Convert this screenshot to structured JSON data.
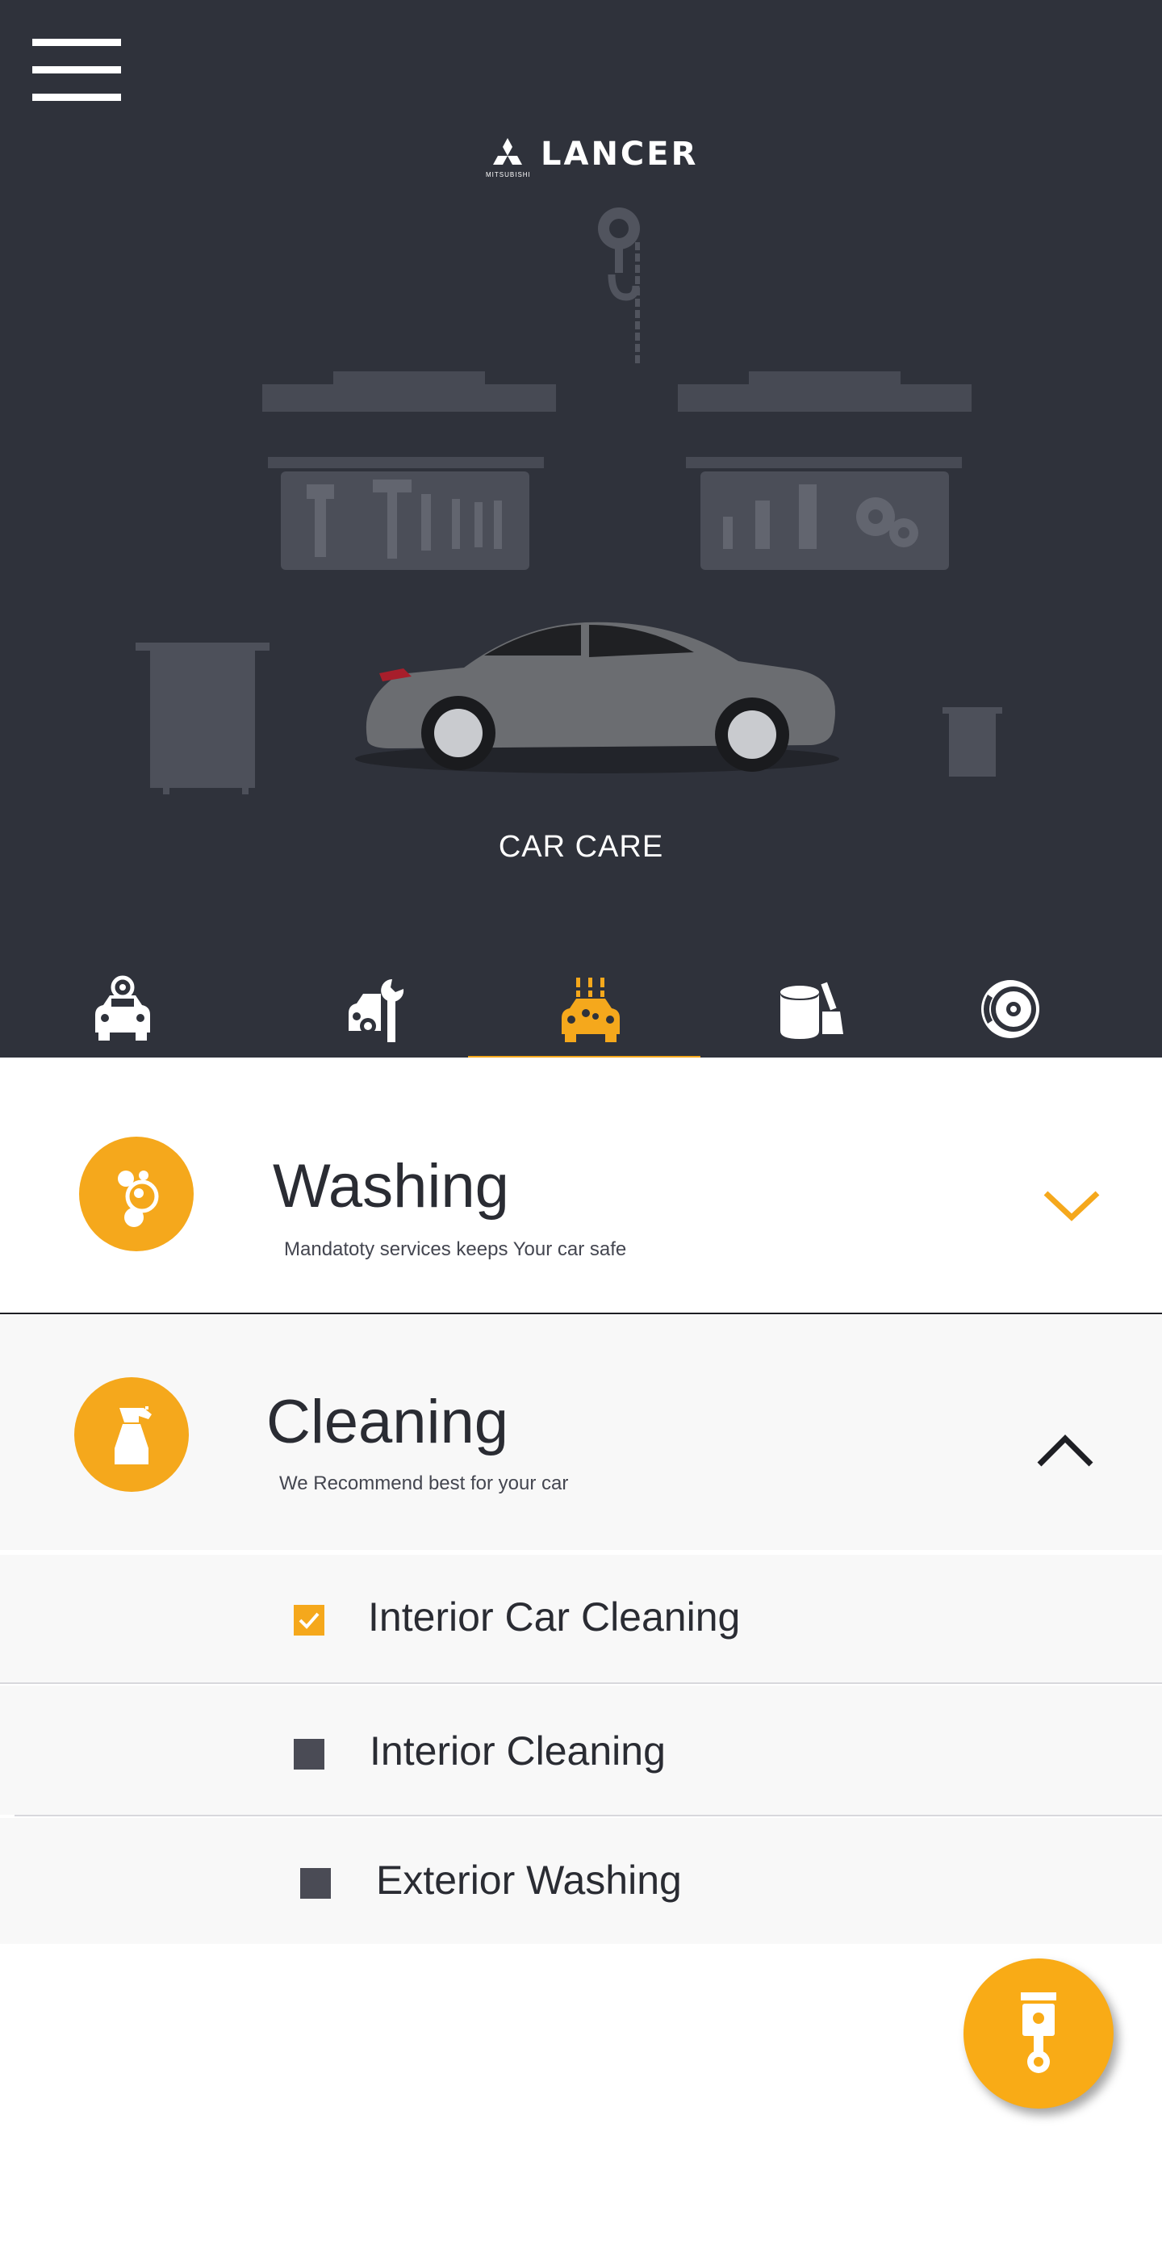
{
  "header": {
    "brand_name": "LANCER",
    "brand_sub": "MITSUBISHI",
    "page_title": "CAR CARE"
  },
  "tabs": [
    {
      "name": "car-service",
      "icon": "car-gear-icon",
      "active": false
    },
    {
      "name": "repair",
      "icon": "car-wrench-icon",
      "active": false
    },
    {
      "name": "car-care",
      "icon": "car-wash-icon",
      "active": true
    },
    {
      "name": "paint",
      "icon": "paint-bucket-icon",
      "active": false
    },
    {
      "name": "brakes",
      "icon": "brake-disc-icon",
      "active": false
    }
  ],
  "sections": {
    "washing": {
      "title": "Washing",
      "subtitle": "Mandatoty services keeps Your car safe",
      "icon": "bubbles-icon",
      "expanded": false
    },
    "cleaning": {
      "title": "Cleaning",
      "subtitle": "We Recommend best for your car",
      "icon": "spray-bottle-icon",
      "expanded": true,
      "items": [
        {
          "label": "Interior Car Cleaning",
          "checked": true
        },
        {
          "label": "Interior Cleaning",
          "checked": false
        },
        {
          "label": "Exterior Washing",
          "checked": false
        }
      ]
    }
  },
  "fab": {
    "icon": "piston-icon"
  },
  "colors": {
    "header_bg": "#2f323b",
    "accent": "#f5a81c",
    "text_dark": "#2a2c33",
    "checkbox_off": "#4a4b55"
  }
}
